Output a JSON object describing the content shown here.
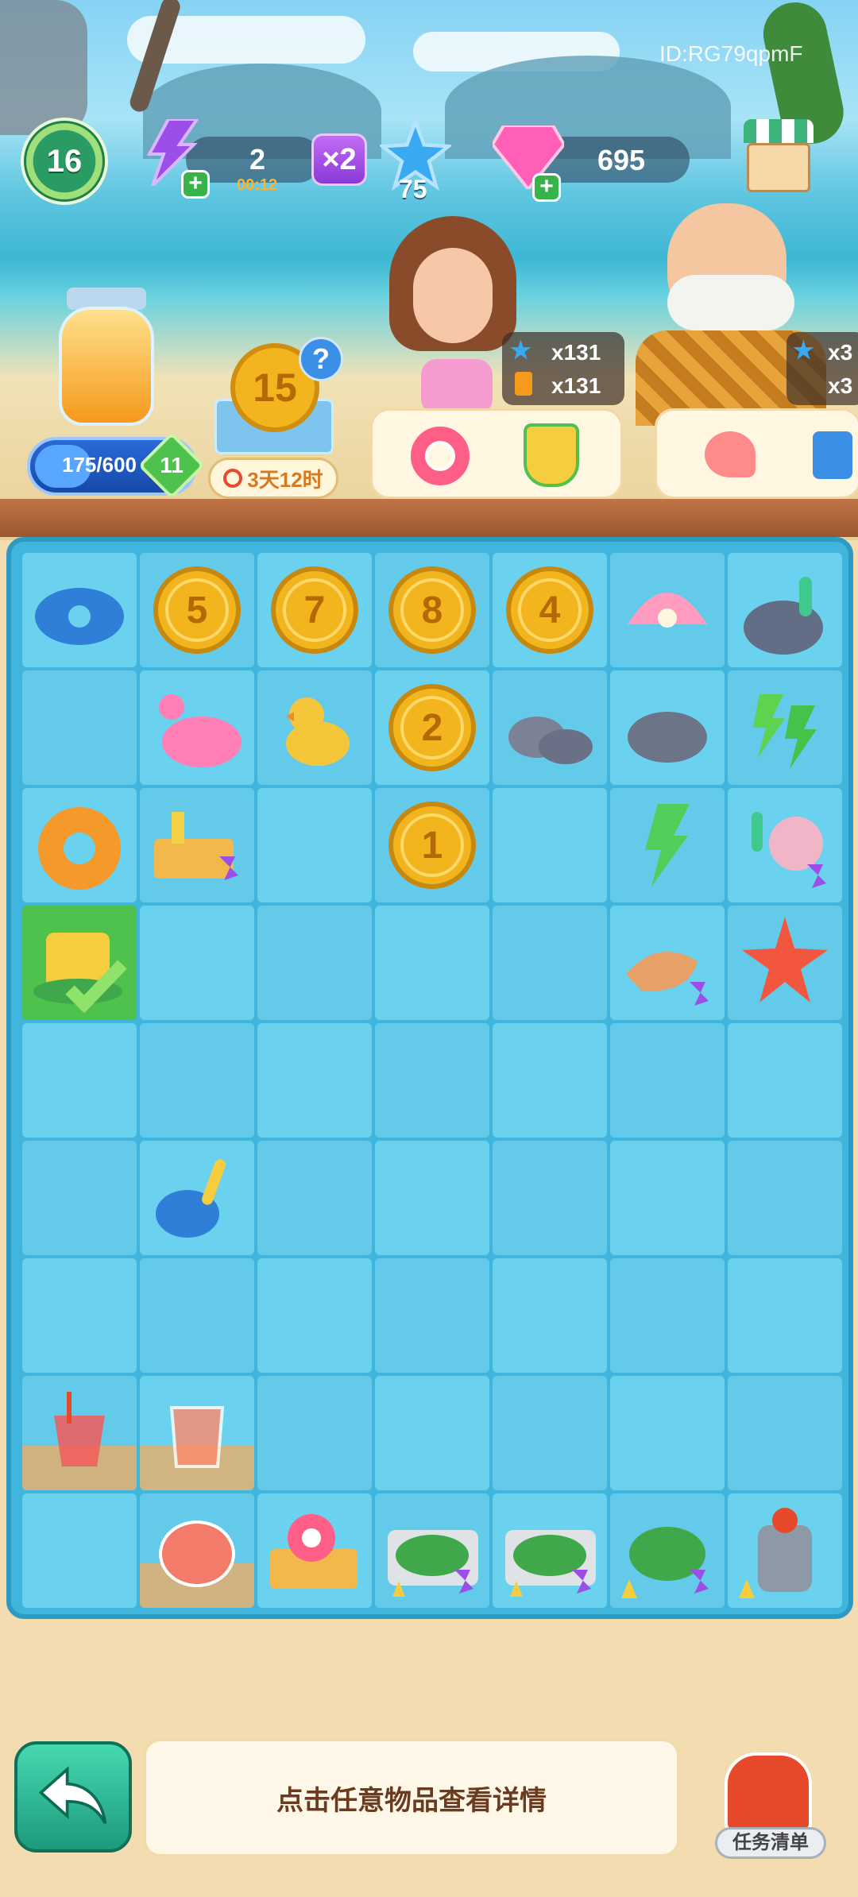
{
  "player_id": "ID:RG79qpmF",
  "hud": {
    "level": "16",
    "energy": "2",
    "energy_timer": "00:12",
    "boost": "×2",
    "stars": "75",
    "gems": "695"
  },
  "jar": {
    "progress_text": "175/600",
    "progress_fraction": 0.29,
    "badge": "11"
  },
  "coin_box": {
    "value": "15",
    "help": "?",
    "timer": "3天12时"
  },
  "orders": [
    {
      "counter_star": "x131",
      "counter_drink": "x131",
      "items": [
        "swim-ring-icon",
        "sandcastle-icon"
      ]
    },
    {
      "counter_star": "x3",
      "counter_drink": "x3",
      "items": [
        "seashell-icon",
        "sand-shovel-icon"
      ]
    }
  ],
  "board": {
    "cells": [
      [
        "whale-float",
        "coin-5",
        "coin-7",
        "coin-8",
        "coin-4",
        "pearl-clam",
        "coral-rock"
      ],
      [
        "",
        "flamingo-float",
        "rubber-duck",
        "coin-2",
        "rocks-pair",
        "rock",
        "energy-bolts"
      ],
      [
        "donut-float",
        "beach-basket",
        "",
        "coin-1",
        "",
        "energy-bolt",
        "coral-shells"
      ],
      [
        "sandcastle-check",
        "",
        "",
        "",
        "",
        "conch-shell",
        "starfish"
      ],
      [
        "",
        "",
        "",
        "",
        "",
        "",
        ""
      ],
      [
        "",
        "sand-shovel",
        "",
        "",
        "",
        "",
        ""
      ],
      [
        "",
        "",
        "",
        "",
        "",
        "",
        ""
      ],
      [
        "juice-glass",
        "juice-cup",
        "",
        "",
        "",
        "",
        ""
      ],
      [
        "",
        "juice-bowl",
        "swim-basket",
        "cactus-tray",
        "cactus-tray",
        "cactus-pot",
        "juicer"
      ]
    ]
  },
  "hint_text": "点击任意物品查看详情",
  "task_list_label": "任务清单",
  "colors": {
    "board": "#40b6de",
    "cell": "#6ad2ef",
    "coin": "#f3b51e",
    "energy": "#9b4ee8",
    "gem": "#ff5fb7"
  }
}
